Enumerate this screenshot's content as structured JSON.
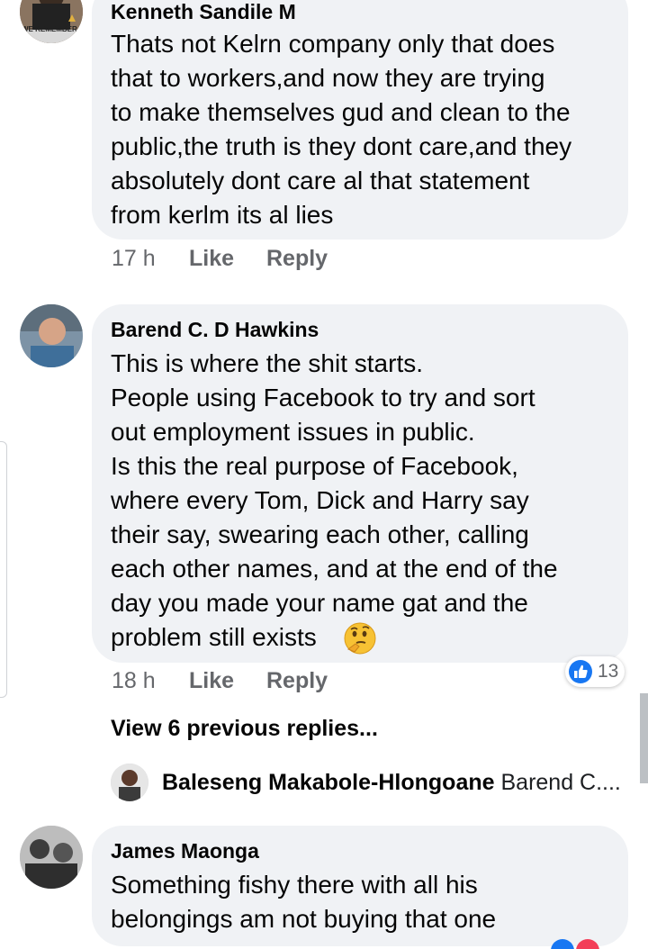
{
  "comments": [
    {
      "author": "Kenneth Sandile M",
      "avatar_badge": "WE REMEMBER",
      "lines": [
        "Thats not Kelrn company only that does",
        "that to workers,and now they are trying",
        "to make themselves gud and clean to the",
        "public,the truth is they dont care,and they",
        "absolutely dont care al that statement",
        "from kerlm its al lies"
      ],
      "time": "17 h",
      "like_label": "Like",
      "reply_label": "Reply"
    },
    {
      "author": "Barend C. D Hawkins",
      "lines": [
        "This is where the shit starts.",
        "People using Facebook to try and sort",
        "out employment issues in public.",
        "Is this the real purpose of Facebook,",
        "where every Tom, Dick and Harry say",
        "their say, swearing each other, calling",
        "each other names, and at the end of the",
        "day you made your name gat and the",
        "problem still exists"
      ],
      "emoji_icon": "thinking-face-icon",
      "time": "18 h",
      "like_label": "Like",
      "reply_label": "Reply",
      "reaction_count": "13",
      "reaction_icon": "like-thumb-icon"
    },
    {
      "author": "James Maonga",
      "lines": [
        "Something fishy there with all his",
        "belongings am not buying that one"
      ]
    }
  ],
  "view_previous_replies": "View 6 previous replies...",
  "reply_preview": {
    "author": "Baleseng Makabole-Hlongoane",
    "snippet": "Barend C...."
  },
  "colors": {
    "bubble": "#f0f2f5",
    "meta_text": "#65676b",
    "like_blue": "#1877f2",
    "love_red": "#f33e58"
  }
}
